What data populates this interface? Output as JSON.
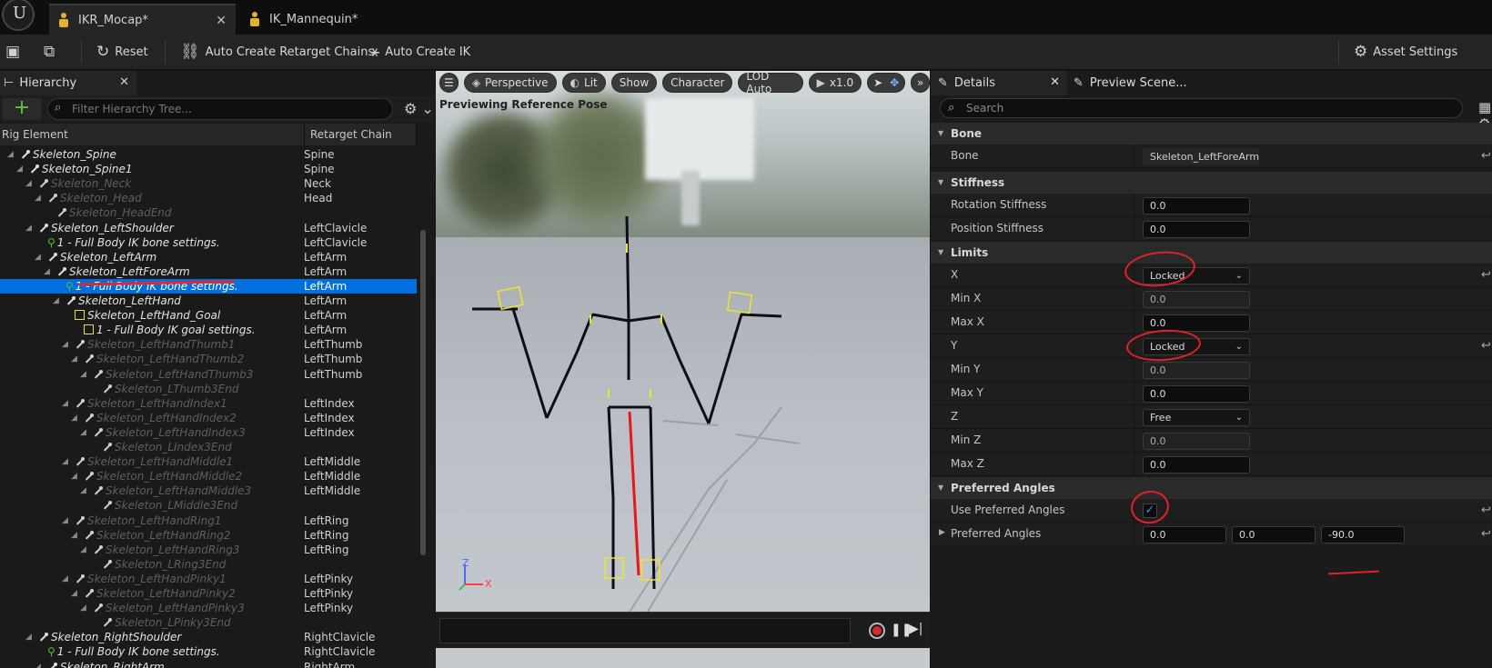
{
  "tabs": [
    {
      "label": "IKR_Mocap*",
      "active": true
    },
    {
      "label": "IK_Mannequin*",
      "active": false
    }
  ],
  "toolbar": {
    "reset": "Reset",
    "auto_chains": "Auto Create Retarget Chains",
    "auto_ik": "Auto Create IK",
    "asset_settings": "Asset Settings"
  },
  "hierarchy": {
    "tab": "Hierarchy",
    "filter_placeholder": "Filter Hierarchy Tree...",
    "col_element": "Rig Element",
    "col_chain": "Retarget Chain",
    "rows": [
      {
        "name": "Skeleton_Spine",
        "chain": "Spine",
        "depth": 0,
        "kind": "bone",
        "dim": false
      },
      {
        "name": "Skeleton_Spine1",
        "chain": "Spine",
        "depth": 1,
        "kind": "bone",
        "dim": false
      },
      {
        "name": "Skeleton_Neck",
        "chain": "Neck",
        "depth": 2,
        "kind": "bone",
        "dim": true
      },
      {
        "name": "Skeleton_Head",
        "chain": "Head",
        "depth": 3,
        "kind": "bone",
        "dim": true
      },
      {
        "name": "Skeleton_HeadEnd",
        "chain": "",
        "depth": 4,
        "kind": "bone",
        "dim": true
      },
      {
        "name": "Skeleton_LeftShoulder",
        "chain": "LeftClavicle",
        "depth": 2,
        "kind": "bone",
        "dim": false
      },
      {
        "name": "1 - Full Body IK bone settings.",
        "chain": "LeftClavicle",
        "depth": 3,
        "kind": "ik",
        "dim": false
      },
      {
        "name": "Skeleton_LeftArm",
        "chain": "LeftArm",
        "depth": 3,
        "kind": "bone",
        "dim": false
      },
      {
        "name": "Skeleton_LeftForeArm",
        "chain": "LeftArm",
        "depth": 4,
        "kind": "bone",
        "dim": false
      },
      {
        "name": "1 - Full Body IK bone settings.",
        "chain": "LeftArm",
        "depth": 5,
        "kind": "ik",
        "dim": false,
        "selected": true
      },
      {
        "name": "Skeleton_LeftHand",
        "chain": "LeftArm",
        "depth": 5,
        "kind": "bone",
        "dim": false
      },
      {
        "name": "Skeleton_LeftHand_Goal",
        "chain": "LeftArm",
        "depth": 6,
        "kind": "goal",
        "dim": false
      },
      {
        "name": "1 - Full Body IK goal settings.",
        "chain": "LeftArm",
        "depth": 7,
        "kind": "goal",
        "dim": false
      },
      {
        "name": "Skeleton_LeftHandThumb1",
        "chain": "LeftThumb",
        "depth": 6,
        "kind": "bone",
        "dim": true
      },
      {
        "name": "Skeleton_LeftHandThumb2",
        "chain": "LeftThumb",
        "depth": 7,
        "kind": "bone",
        "dim": true
      },
      {
        "name": "Skeleton_LeftHandThumb3",
        "chain": "LeftThumb",
        "depth": 8,
        "kind": "bone",
        "dim": true
      },
      {
        "name": "Skeleton_LThumb3End",
        "chain": "",
        "depth": 9,
        "kind": "bone",
        "dim": true
      },
      {
        "name": "Skeleton_LeftHandIndex1",
        "chain": "LeftIndex",
        "depth": 6,
        "kind": "bone",
        "dim": true
      },
      {
        "name": "Skeleton_LeftHandIndex2",
        "chain": "LeftIndex",
        "depth": 7,
        "kind": "bone",
        "dim": true
      },
      {
        "name": "Skeleton_LeftHandIndex3",
        "chain": "LeftIndex",
        "depth": 8,
        "kind": "bone",
        "dim": true
      },
      {
        "name": "Skeleton_LIndex3End",
        "chain": "",
        "depth": 9,
        "kind": "bone",
        "dim": true
      },
      {
        "name": "Skeleton_LeftHandMiddle1",
        "chain": "LeftMiddle",
        "depth": 6,
        "kind": "bone",
        "dim": true
      },
      {
        "name": "Skeleton_LeftHandMiddle2",
        "chain": "LeftMiddle",
        "depth": 7,
        "kind": "bone",
        "dim": true
      },
      {
        "name": "Skeleton_LeftHandMiddle3",
        "chain": "LeftMiddle",
        "depth": 8,
        "kind": "bone",
        "dim": true
      },
      {
        "name": "Skeleton_LMiddle3End",
        "chain": "",
        "depth": 9,
        "kind": "bone",
        "dim": true
      },
      {
        "name": "Skeleton_LeftHandRing1",
        "chain": "LeftRing",
        "depth": 6,
        "kind": "bone",
        "dim": true
      },
      {
        "name": "Skeleton_LeftHandRing2",
        "chain": "LeftRing",
        "depth": 7,
        "kind": "bone",
        "dim": true
      },
      {
        "name": "Skeleton_LeftHandRing3",
        "chain": "LeftRing",
        "depth": 8,
        "kind": "bone",
        "dim": true
      },
      {
        "name": "Skeleton_LRing3End",
        "chain": "",
        "depth": 9,
        "kind": "bone",
        "dim": true
      },
      {
        "name": "Skeleton_LeftHandPinky1",
        "chain": "LeftPinky",
        "depth": 6,
        "kind": "bone",
        "dim": true
      },
      {
        "name": "Skeleton_LeftHandPinky2",
        "chain": "LeftPinky",
        "depth": 7,
        "kind": "bone",
        "dim": true
      },
      {
        "name": "Skeleton_LeftHandPinky3",
        "chain": "LeftPinky",
        "depth": 8,
        "kind": "bone",
        "dim": true
      },
      {
        "name": "Skeleton_LPinky3End",
        "chain": "",
        "depth": 9,
        "kind": "bone",
        "dim": true
      },
      {
        "name": "Skeleton_RightShoulder",
        "chain": "RightClavicle",
        "depth": 2,
        "kind": "bone",
        "dim": false
      },
      {
        "name": "1 - Full Body IK bone settings.",
        "chain": "RightClavicle",
        "depth": 3,
        "kind": "ik",
        "dim": false
      },
      {
        "name": "Skeleton_RightArm",
        "chain": "RightArm",
        "depth": 3,
        "kind": "bone",
        "dim": false
      }
    ]
  },
  "viewport": {
    "perspective": "Perspective",
    "lit": "Lit",
    "show": "Show",
    "character": "Character",
    "lod": "LOD Auto",
    "speed": "x1.0",
    "info": "Previewing Reference Pose",
    "axis_z": "Z",
    "axis_x": "X"
  },
  "details": {
    "tab": "Details",
    "tab2": "Preview Scene...",
    "search_placeholder": "Search",
    "sections": {
      "bone": "Bone",
      "stiffness": "Stiffness",
      "limits": "Limits",
      "preferred": "Preferred Angles"
    },
    "bone_label": "Bone",
    "bone_value": "Skeleton_LeftForeArm",
    "rotation_stiffness_label": "Rotation Stiffness",
    "rotation_stiffness": "0.0",
    "position_stiffness_label": "Position Stiffness",
    "position_stiffness": "0.0",
    "x_label": "X",
    "x_value": "Locked",
    "minx_label": "Min X",
    "minx": "0.0",
    "maxx_label": "Max X",
    "maxx": "0.0",
    "y_label": "Y",
    "y_value": "Locked",
    "miny_label": "Min Y",
    "miny": "0.0",
    "maxy_label": "Max Y",
    "maxy": "0.0",
    "z_label": "Z",
    "z_value": "Free",
    "minz_label": "Min Z",
    "minz": "0.0",
    "maxz_label": "Max Z",
    "maxz": "0.0",
    "use_pref_label": "Use Preferred Angles",
    "use_pref_checked": "✓",
    "pref_angles_label": "Preferred Angles",
    "pref_x": "0.0",
    "pref_y": "0.0",
    "pref_z": "-90.0"
  },
  "colors": {
    "selection": "#0070e0",
    "annotation": "#e0212a",
    "ik_green": "#4fbf3a",
    "goal_yellow": "#e7df42"
  }
}
